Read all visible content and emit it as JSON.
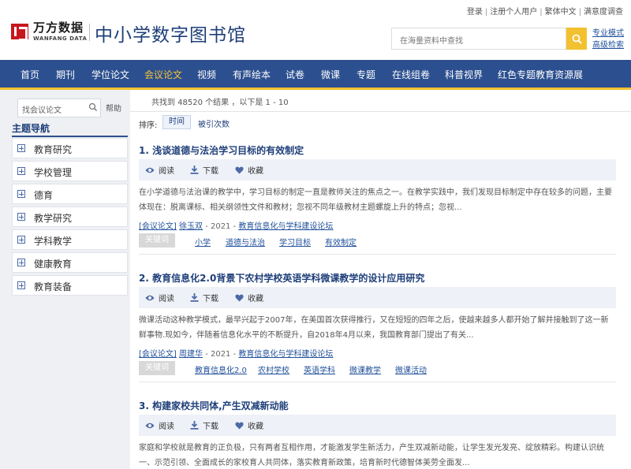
{
  "top_links": [
    "登录",
    "注册个人用户",
    "繁体中文",
    "满意度调查"
  ],
  "logo": {
    "text": "万方数据",
    "sub": "WANFANG DATA"
  },
  "site_title": "中小学数字图书馆",
  "search": {
    "placeholder": "在海量资料中查找"
  },
  "adv_links": {
    "pro_mode": "专业模式",
    "advanced": "高级检索"
  },
  "nav": [
    {
      "label": "首页"
    },
    {
      "label": "期刊"
    },
    {
      "label": "学位论文"
    },
    {
      "label": "会议论文",
      "active": true
    },
    {
      "label": "视频"
    },
    {
      "label": "有声绘本"
    },
    {
      "label": "试卷"
    },
    {
      "label": "微课"
    },
    {
      "label": "专题"
    },
    {
      "label": "在线组卷"
    },
    {
      "label": "科普视界"
    },
    {
      "label": "红色专题教育资源展"
    }
  ],
  "sidebar": {
    "search_placeholder": "找会议论文",
    "help": "帮助",
    "topic_title": "主题导航",
    "topics": [
      "教育研究",
      "学校管理",
      "德育",
      "教学研究",
      "学科教学",
      "健康教育",
      "教育装备"
    ]
  },
  "results": {
    "summary": "共找到 48520 个结果 ，以下是 1 - 10",
    "sort_label": "排序:",
    "sort_time": "时间",
    "sort_cite": "被引次数"
  },
  "actions": {
    "read": "阅读",
    "download": "下载",
    "favorite": "收藏"
  },
  "keyword_tag": "关键词",
  "items": [
    {
      "title": "1. 浅谈道德与法治学习目标的有效制定",
      "abstract": "在小学道德与法治课的教学中，学习目标的制定一直是教师关注的焦点之一。在教学实践中，我们发现目标制定中存在较多的问题，主要体现在：脱离课标、相关纲领性文件和教材；忽视不同年级教材主题螺旋上升的特点；忽视...",
      "type": "[会议论文]",
      "author": "徐玉双",
      "year": "- 2021 -",
      "source": "教育信息化与学科建设论坛",
      "keywords": [
        "小学",
        "道德与法治",
        "学习目标",
        "有效制定"
      ]
    },
    {
      "title": "2. 教育信息化2.0背景下农村学校英语学科微课教学的设计应用研究",
      "abstract": "微课活动这种教学模式，最早兴起于2007年，在美国首次获得推行，又在短短的四年之后，使越来越多人都开始了解并接触到了这一新鲜事物.现如今，伴随着信息化水平的不断提升，自2018年4月以来，我国教育部门提出了有关...",
      "type": "[会议论文]",
      "author": "周建华",
      "year": "- 2021 -",
      "source": "教育信息化与学科建设论坛",
      "keywords": [
        "教育信息化2.0",
        "农村学校",
        "英语学科",
        "微课教学",
        "微课活动"
      ]
    },
    {
      "title": "3. 构建家校共同体,产生双减新动能",
      "abstract": "家庭和学校就是教育的正负极，只有两者互相作用，才能激发学生新活力，产生双减新动能，让学生发光发亮、绽放精彩。构建认识统一、示范引领、全面成长的家校育人共同体，落实教育新政策，培育新时代德智体美劳全面发..."
    }
  ],
  "colors": {
    "nav_bg": "#2c4f8f",
    "nav_active": "#f6c536",
    "accent": "#f3c12f",
    "title_blue": "#1f3f7a",
    "logo_red": "#c8161d"
  }
}
